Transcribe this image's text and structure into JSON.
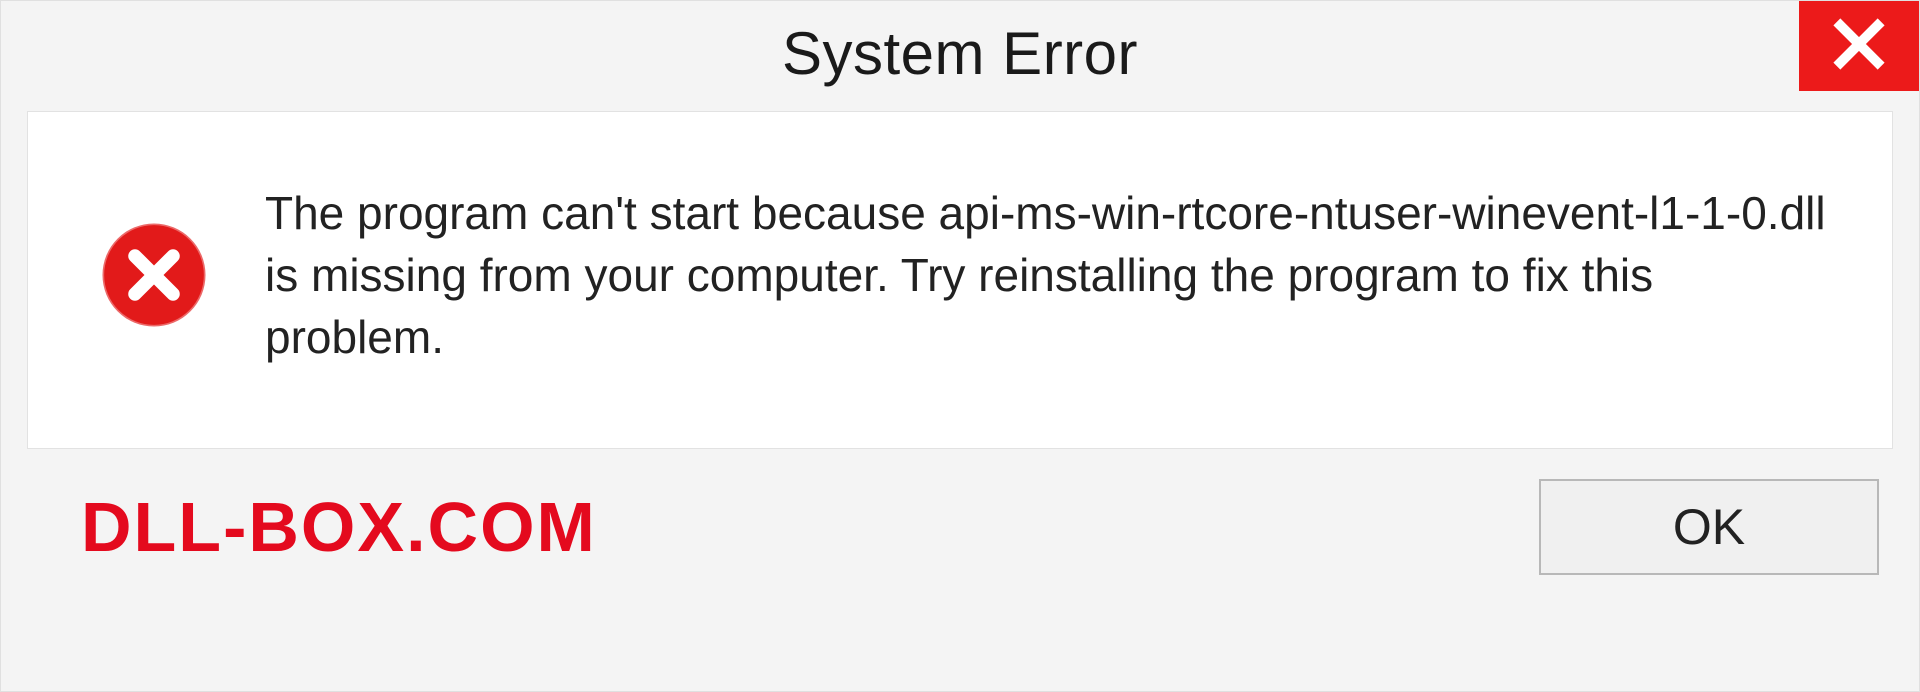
{
  "dialog": {
    "title": "System Error",
    "message": "The program can't start because api-ms-win-rtcore-ntuser-winevent-l1-1-0.dll is missing from your computer. Try reinstalling the program to fix this problem.",
    "ok_label": "OK"
  },
  "watermark": {
    "text": "DLL-BOX.COM"
  },
  "colors": {
    "close_bg": "#ec1a1a",
    "error_icon": "#e21a1a",
    "watermark": "#e40a1e"
  }
}
